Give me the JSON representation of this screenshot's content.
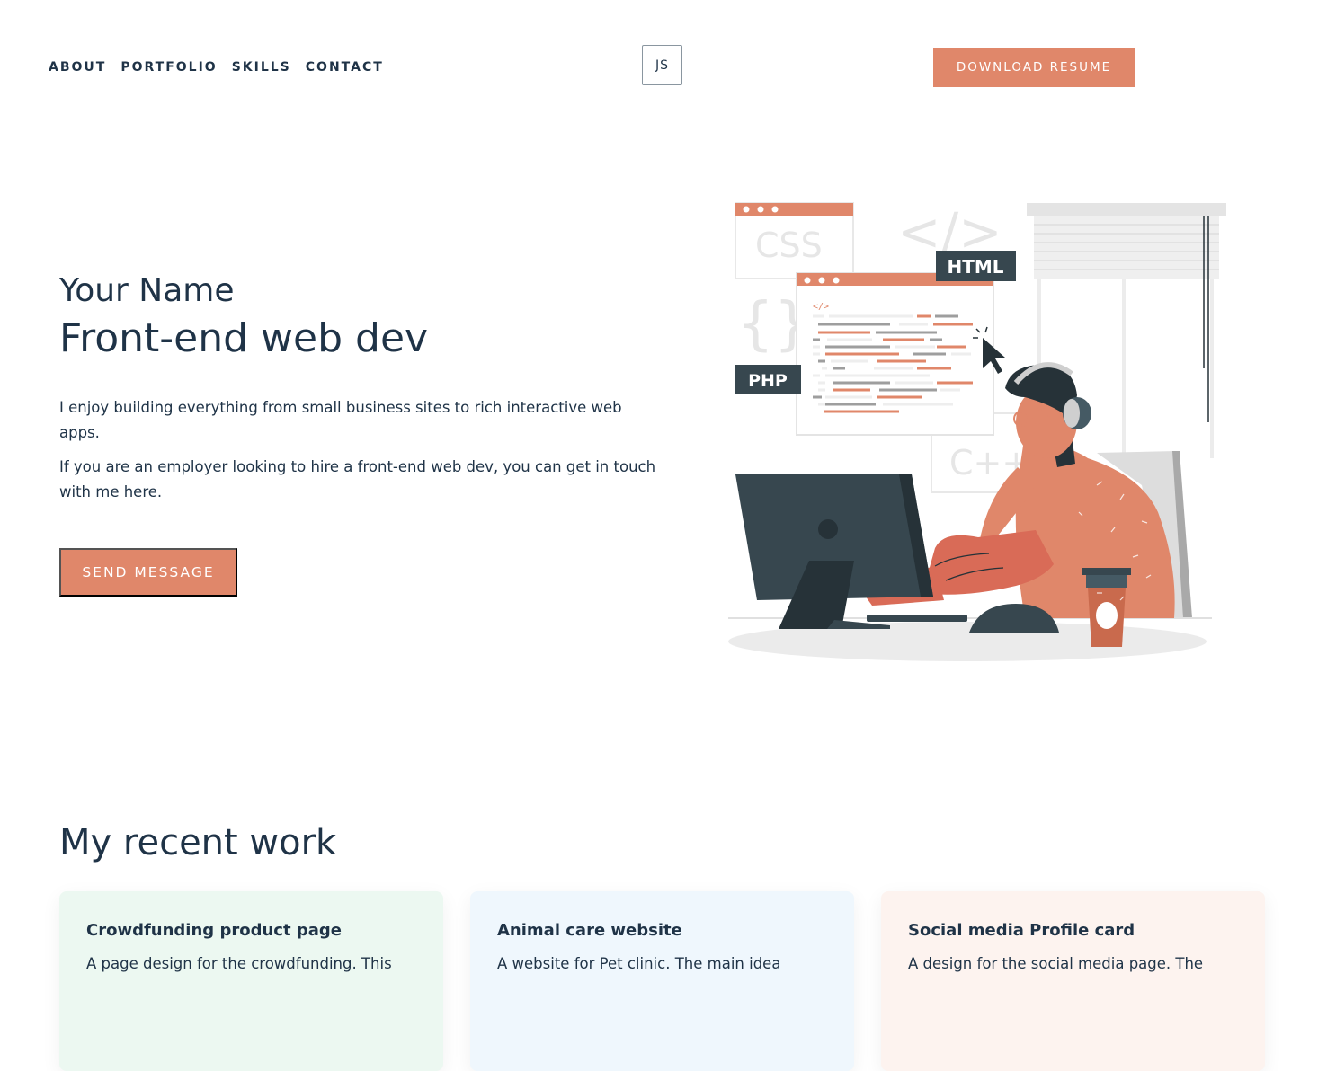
{
  "nav": {
    "links": [
      "ABOUT",
      "PORTFOLIO",
      "SKILLS",
      "CONTACT"
    ],
    "logo": "JS",
    "resume_button": "DOWNLOAD RESUME"
  },
  "hero": {
    "name": "Your Name",
    "role": "Front-end web dev",
    "paragraph_1": "I enjoy building everything from small business sites to rich interactive web apps.",
    "paragraph_2": "If you are an employer looking to hire a front-end web dev, you can get in touch with me here.",
    "send_button": "SEND MESSAGE",
    "illustration_labels": {
      "css": "CSS",
      "html": "HTML",
      "php": "PHP",
      "cpp": "C++",
      "braces": "{}",
      "tag": "</>"
    }
  },
  "work": {
    "title": "My recent work",
    "cards": [
      {
        "title": "Crowdfunding product page",
        "desc": "A page design for the crowdfunding. This"
      },
      {
        "title": "Animal care website",
        "desc": "A website for Pet clinic. The main idea"
      },
      {
        "title": "Social media Profile card",
        "desc": "A design for the social media page. The"
      }
    ]
  },
  "colors": {
    "accent": "#e0876a",
    "text": "#1f3347",
    "dark_monitor": "#37474f"
  }
}
